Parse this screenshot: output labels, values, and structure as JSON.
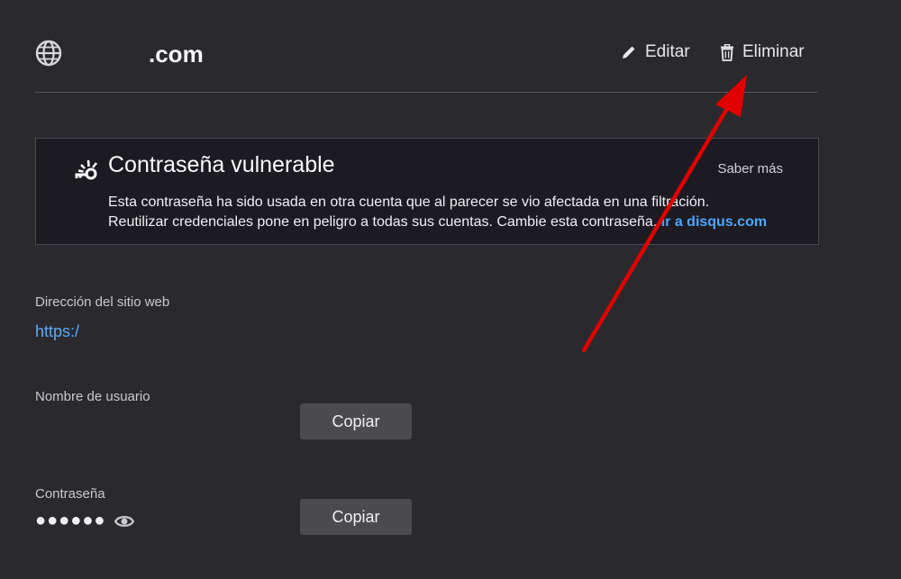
{
  "header": {
    "site_title": ".com",
    "edit_label": "Editar",
    "delete_label": "Eliminar"
  },
  "alert": {
    "title": "Contraseña vulnerable",
    "learn_more": "Saber más",
    "line1": "Esta contraseña ha sido usada en otra cuenta que al parecer se vio afectada en una filtración.",
    "line2": "Reutilizar credenciales pone en peligro a todas sus cuentas. Cambie esta contraseña.",
    "link": "Ir a disqus.com"
  },
  "fields": {
    "website": {
      "label": "Dirección del sitio web",
      "value": "https:/"
    },
    "username": {
      "label": "Nombre de usuario",
      "copy_label": "Copiar"
    },
    "password": {
      "label": "Contraseña",
      "masked_value": "●●●●●●",
      "copy_label": "Copiar"
    }
  },
  "colors": {
    "background": "#2a2a2e",
    "link": "#4fa6ff",
    "annotation_arrow": "#e00000"
  },
  "icons": [
    "globe-icon",
    "pencil-icon",
    "trash-icon",
    "broken-key-icon",
    "eye-icon"
  ]
}
